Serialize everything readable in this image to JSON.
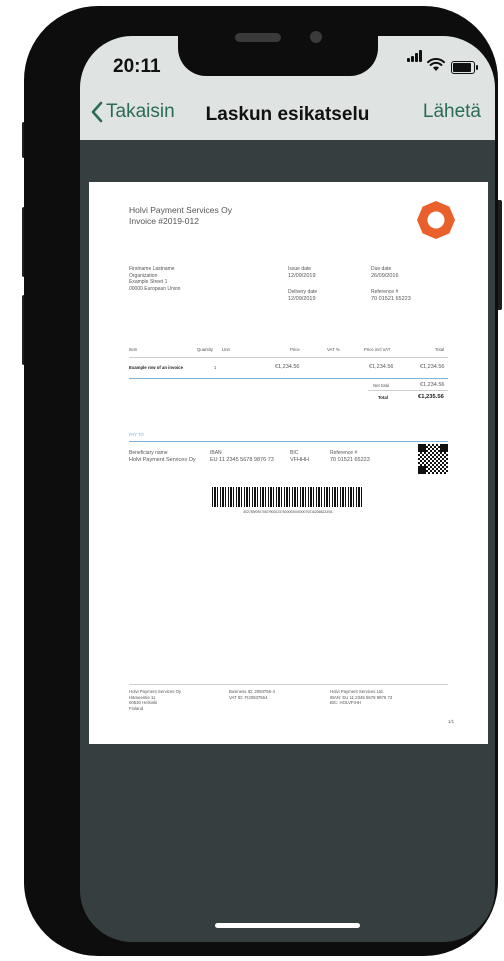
{
  "status": {
    "time": "20:11"
  },
  "nav": {
    "back_label": "Takaisin",
    "title": "Laskun esikatselu",
    "send_label": "Lähetä"
  },
  "colors": {
    "accent": "#2c6b55",
    "logo": "#e8612c",
    "rule": "#7fb3d7"
  },
  "invoice": {
    "company": "Holvi Payment Services Oy",
    "number": "Invoice #2019-012",
    "recipient": [
      "Firstname Lastname",
      "Organization",
      "Example Street 1",
      "00000 European Union"
    ],
    "issue_date_label": "Issue date",
    "issue_date": "12/09/2019",
    "due_date_label": "Due date",
    "due_date": "26/09/2016",
    "delivery_date_label": "Delivery date",
    "delivery_date": "12/09/2019",
    "reference_label": "Reference #",
    "reference": "70 01521 65223",
    "columns": {
      "item": "Item",
      "quantity": "Quantity",
      "unit": "Unit",
      "price": "Price",
      "vat": "VAT %",
      "price_incl_vat": "Price incl VAT",
      "total": "Total"
    },
    "row": {
      "item": "Example row of an invoice",
      "quantity": "1",
      "price": "€1,234.56",
      "price_incl_vat": "€1,234.56",
      "total": "€1,234.56"
    },
    "net_total_label": "Net total",
    "net_total": "€1,234.56",
    "total_label": "Total",
    "total": "€1,235.56",
    "pay_to_label": "PAY TO",
    "beneficiary_label": "Beneficiary name",
    "beneficiary": "Holvi Payment Services Oy",
    "iban_label": "IBAN",
    "iban": "EU 11 2345 5678 9876 73",
    "bic_label": "BIC",
    "bic": "VFHHH",
    "reference2_label": "Reference #",
    "reference2": "70 01521 65223",
    "barcode_text": "402789/0907087/9000237500000000000700152065223/51",
    "footer_col1": [
      "Holvi Payment Services Oy",
      "Hämeentie 11",
      "00530 Helsinki",
      "Finland"
    ],
    "footer_col2": [
      "Business ID: 2093756-4",
      "VAT ID: FI20937564"
    ],
    "footer_col3": [
      "Holvi Payment Services Ltd.",
      "IBAN: EU 11 2345 5678 9876 73",
      "BIC: HOLVFIHH"
    ],
    "page": "1/1"
  }
}
